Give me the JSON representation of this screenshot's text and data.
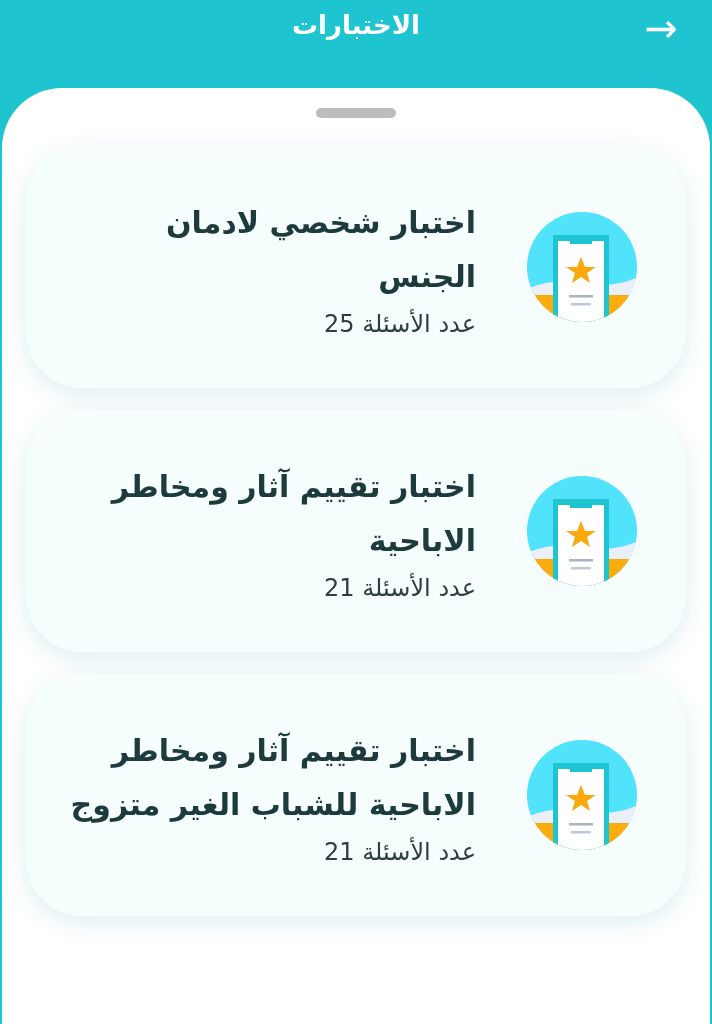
{
  "header": {
    "title": "الاختبارات",
    "back_icon": "→"
  },
  "tests": [
    {
      "title": "اختبار شخصي لادمان الجنس",
      "count": "عدد الأسئلة 25"
    },
    {
      "title": "اختبار تقييم آثار ومخاطر الاباحية",
      "count": "عدد الأسئلة 21"
    },
    {
      "title": "اختبار تقييم آثار ومخاطر الاباحية للشباب الغير متزوج",
      "count": "عدد الأسئلة 21"
    }
  ]
}
